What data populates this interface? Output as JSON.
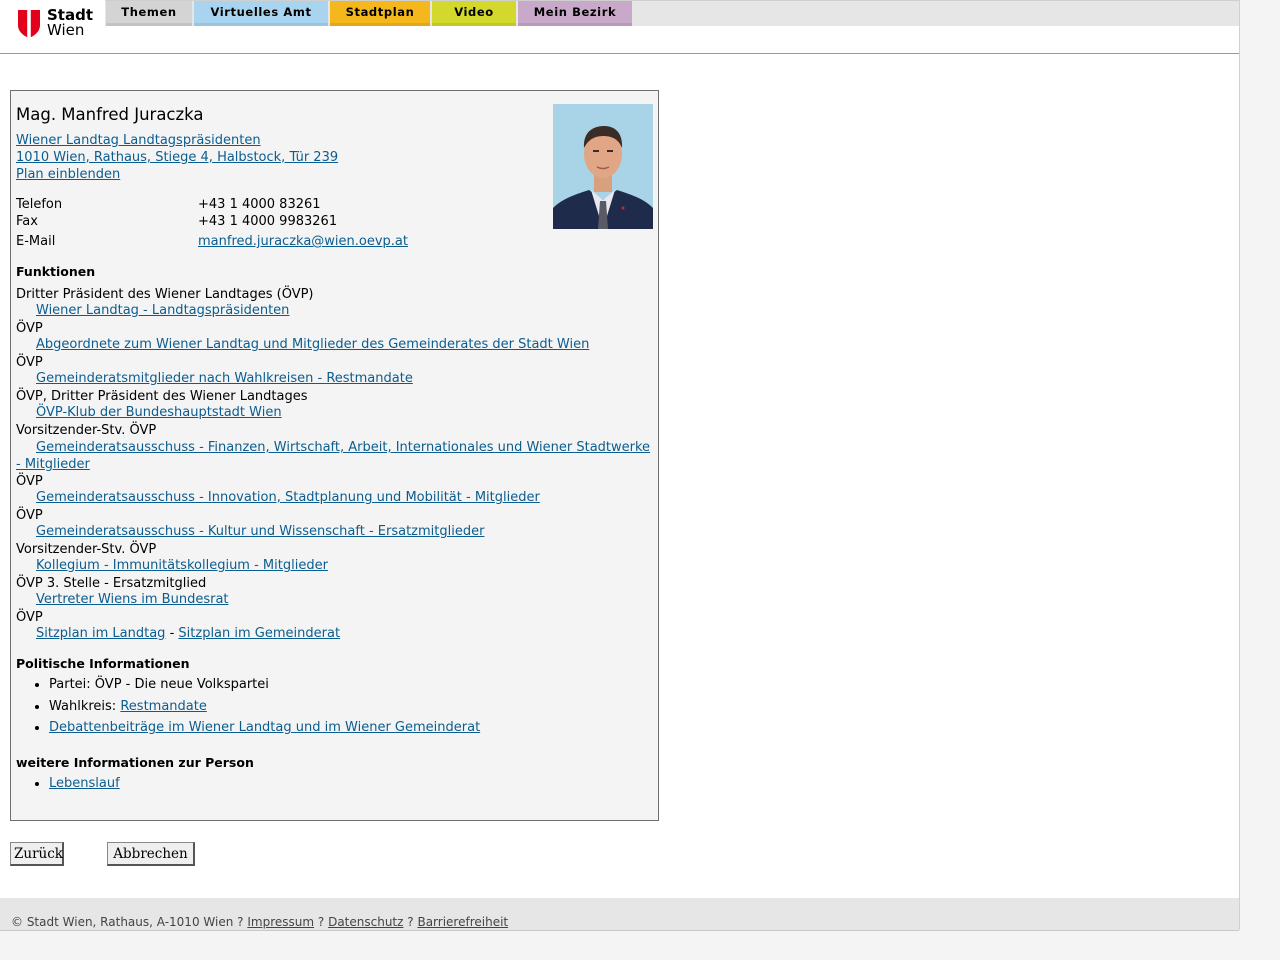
{
  "logo": {
    "line1": "Stadt",
    "line2": "Wien"
  },
  "nav": [
    "Themen",
    "Virtuelles Amt",
    "Stadtplan",
    "Video",
    "Mein Bezirk"
  ],
  "person": {
    "name": "Mag. Manfred Juraczka",
    "org_link": "Wiener Landtag Landtagspräsidenten",
    "address_link": "1010 Wien, Rathaus, Stiege 4, Halbstock, Tür 239",
    "plan_link": "Plan einblenden",
    "contacts": [
      {
        "label": "Telefon",
        "value": "+43 1 4000 83261"
      },
      {
        "label": "Fax",
        "value": "+43 1 4000 9983261"
      },
      {
        "label": "E-Mail",
        "value": "manfred.juraczka@wien.oevp.at"
      }
    ]
  },
  "funktionen_heading": "Funktionen",
  "funktionen": [
    {
      "role": "Dritter Präsident des Wiener Landtages (ÖVP)",
      "link": "Wiener Landtag - Landtagspräsidenten"
    },
    {
      "role": "ÖVP",
      "link": "Abgeordnete zum Wiener Landtag und Mitglieder des Gemeinderates der Stadt Wien"
    },
    {
      "role": "ÖVP",
      "link": "Gemeinderatsmitglieder nach Wahlkreisen - Restmandate"
    },
    {
      "role": "ÖVP, Dritter Präsident des Wiener Landtages",
      "link": "ÖVP-Klub der Bundeshauptstadt Wien"
    },
    {
      "role": "Vorsitzender-Stv. ÖVP",
      "link": "Gemeinderatsausschuss - Finanzen, Wirtschaft, Arbeit, Internationales und Wiener Stadtwerke - Mitglieder"
    },
    {
      "role": "ÖVP",
      "link": "Gemeinderatsausschuss - Innovation, Stadtplanung und Mobilität - Mitglieder"
    },
    {
      "role": "ÖVP",
      "link": "Gemeinderatsausschuss - Kultur und Wissenschaft - Ersatzmitglieder"
    },
    {
      "role": "Vorsitzender-Stv. ÖVP",
      "link": "Kollegium - Immunitätskollegium - Mitglieder"
    },
    {
      "role": "ÖVP 3. Stelle - Ersatzmitglied",
      "link": "Vertreter Wiens im Bundesrat"
    },
    {
      "role": "ÖVP"
    }
  ],
  "sitzplan": {
    "landtag": "Sitzplan im Landtag",
    "sep": "-",
    "gemeinderat": "Sitzplan im Gemeinderat"
  },
  "politisch": {
    "heading": "Politische Informationen",
    "partei_label": "Partei:",
    "partei_value": "ÖVP - Die neue Volkspartei",
    "wahlkreis_label": "Wahlkreis:",
    "wahlkreis_link": "Restmandate",
    "debatten_link": "Debattenbeiträge im Wiener Landtag und im Wiener Gemeinderat"
  },
  "weitere": {
    "heading": "weitere Informationen zur Person",
    "link": "Lebenslauf"
  },
  "buttons": {
    "back": "Zurück",
    "cancel": "Abbrechen"
  },
  "footer": {
    "copyright": "© Stadt Wien, Rathaus, A-1010 Wien",
    "sep": "?",
    "impressum": "Impressum",
    "datenschutz": "Datenschutz",
    "barrierefreiheit": "Barrierefreiheit"
  },
  "colors": {
    "link": "#0b5d8f",
    "logo_red": "#e2001a",
    "tab_themen": "#d4d4d4",
    "tab_amt": "#a8d4ef",
    "tab_plan": "#f5b81c",
    "tab_video": "#d3d82c",
    "tab_bezirk": "#c9a9c9"
  }
}
